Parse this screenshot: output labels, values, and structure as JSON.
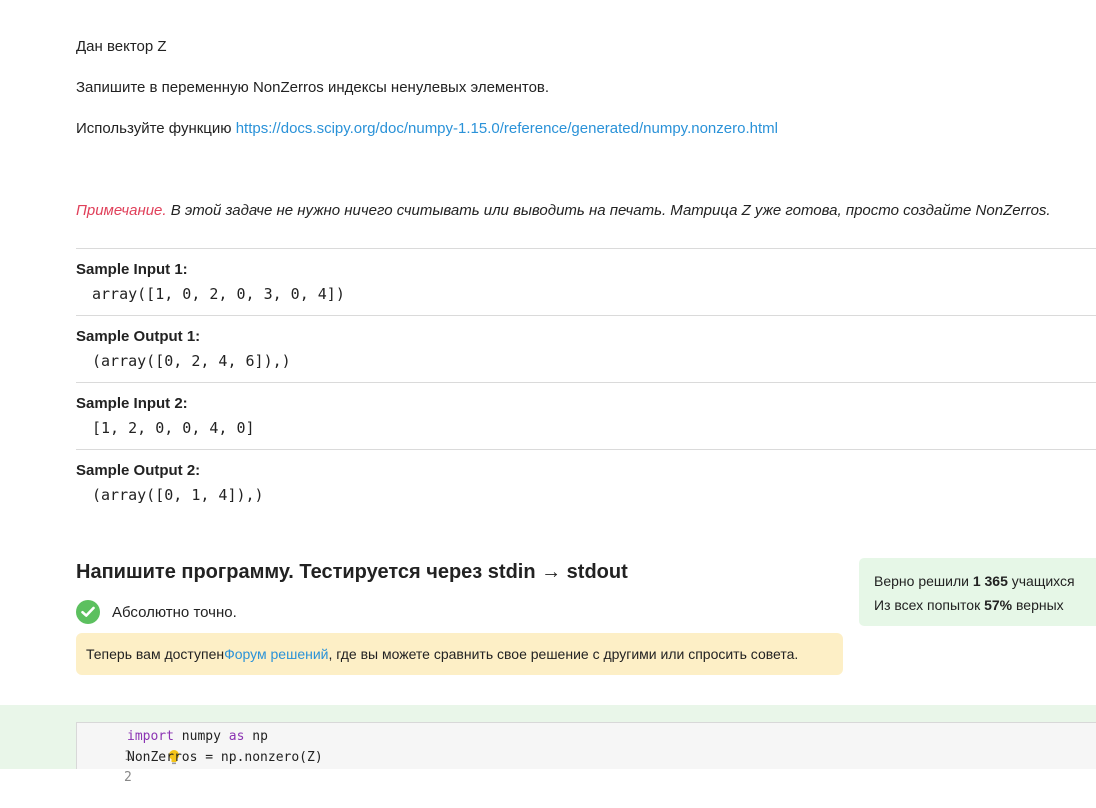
{
  "task": {
    "line1": "Дан вектор Z",
    "line2": "Запишите в переменную NonZerros индексы ненулевых элементов.",
    "line3_prefix": "Используйте функцию ",
    "line3_link": "https://docs.scipy.org/doc/numpy-1.15.0/reference/generated/numpy.nonzero.html",
    "note_label": "Примечание.",
    "note_text": " В этой задаче не нужно ничего считывать или выводить на печать. Матрица Z уже готова, просто создайте NonZerros."
  },
  "samples": [
    {
      "title": "Sample Input 1:",
      "code": "array([1, 0, 2, 0, 3, 0, 4])"
    },
    {
      "title": "Sample Output 1:",
      "code": "(array([0, 2, 4, 6]),)"
    },
    {
      "title": "Sample Input 2:",
      "code": "[1, 2, 0, 0, 4, 0]"
    },
    {
      "title": "Sample Output 2:",
      "code": "(array([0, 1, 4]),)"
    }
  ],
  "section": {
    "title": "Напишите программу. Тестируется через stdin → stdout",
    "status": "Абсолютно точно."
  },
  "forum": {
    "prefix": "Теперь вам доступен ",
    "link": "Форум решений",
    "suffix": " , где вы можете сравнить свое решение с другими или спросить совета."
  },
  "stats": {
    "line1_prefix": "Верно решили ",
    "line1_value": "1 365",
    "line1_suffix": " учащихся",
    "line2_prefix": "Из всех попыток ",
    "line2_value": "57%",
    "line2_suffix": " верных"
  },
  "editor": {
    "lines": [
      {
        "num": "1",
        "kw1": "import",
        "mid": " numpy ",
        "kw2": "as",
        "rest": " np"
      },
      {
        "num": "2",
        "text": "NonZerros = np.nonzero(Z)"
      }
    ]
  },
  "colors": {
    "link": "#2a92d8",
    "note": "#e0405a",
    "success": "#5cc05f",
    "keyword": "#8b33b3"
  },
  "icons": [
    "check-circle-icon",
    "lightbulb-icon"
  ]
}
